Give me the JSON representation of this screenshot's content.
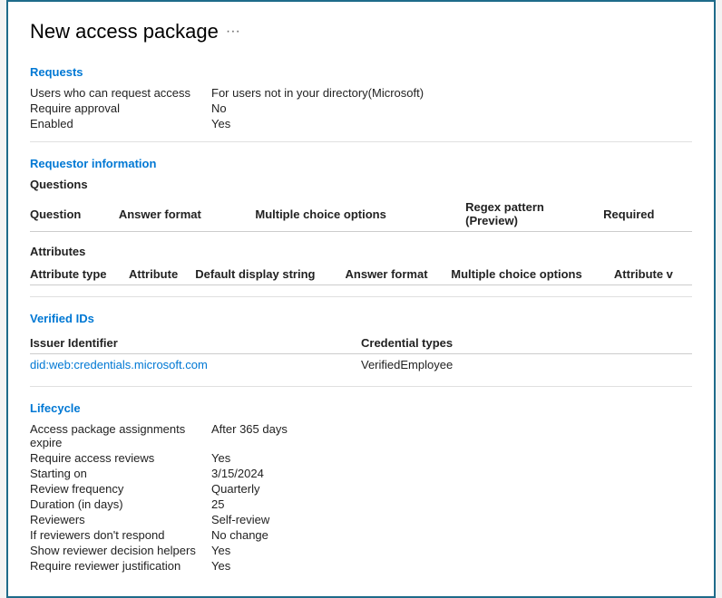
{
  "page": {
    "title": "New access package",
    "more_icon": "···"
  },
  "sections": {
    "requests": {
      "heading": "Requests",
      "fields": [
        {
          "label": "Users who can request access",
          "value": "For users not in your directory(Microsoft)"
        },
        {
          "label": "Require approval",
          "value": "No"
        },
        {
          "label": "Enabled",
          "value": "Yes"
        }
      ]
    },
    "requestor_information": {
      "heading": "Requestor information",
      "questions": {
        "sub_heading": "Questions",
        "columns": [
          "Question",
          "Answer format",
          "Multiple choice options",
          "Regex pattern (Preview)",
          "Required"
        ],
        "rows": []
      },
      "attributes": {
        "sub_heading": "Attributes",
        "columns": [
          "Attribute type",
          "Attribute",
          "Default display string",
          "Answer format",
          "Multiple choice options",
          "Attribute v"
        ],
        "rows": []
      }
    },
    "verified_ids": {
      "heading": "Verified IDs",
      "columns": [
        "Issuer Identifier",
        "Credential types"
      ],
      "rows": [
        {
          "issuer": "did:web:credentials.microsoft.com",
          "credential": "VerifiedEmployee"
        }
      ]
    },
    "lifecycle": {
      "heading": "Lifecycle",
      "fields": [
        {
          "label": "Access package assignments expire",
          "value": "After 365 days"
        },
        {
          "label": "Require access reviews",
          "value": "Yes"
        },
        {
          "label": "Starting on",
          "value": "3/15/2024"
        },
        {
          "label": "Review frequency",
          "value": "Quarterly"
        },
        {
          "label": "Duration (in days)",
          "value": "25"
        },
        {
          "label": "Reviewers",
          "value": "Self-review"
        },
        {
          "label": "If reviewers don't respond",
          "value": "No change"
        },
        {
          "label": "Show reviewer decision helpers",
          "value": "Yes"
        },
        {
          "label": "Require reviewer justification",
          "value": "Yes"
        }
      ]
    }
  }
}
